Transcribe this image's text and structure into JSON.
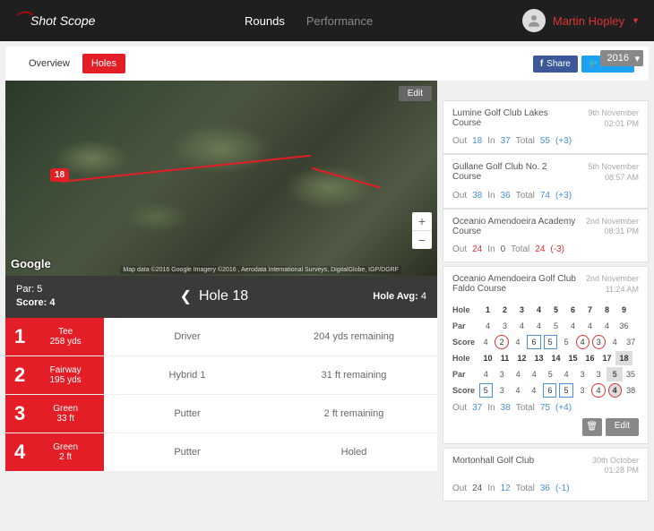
{
  "header": {
    "logo_text": "Shot Scope",
    "nav": {
      "rounds": "Rounds",
      "performance": "Performance"
    },
    "user_name": "Martin Hopley"
  },
  "toolbar": {
    "overview": "Overview",
    "holes": "Holes",
    "share": "Share",
    "tweet": "Tweet",
    "year": "2016"
  },
  "map": {
    "edit": "Edit",
    "google": "Google",
    "attribution": "Map data ©2016 Google Imagery ©2016 , Aerodata International Surveys, DigitalGlobe, IGP/DGRF",
    "hole_marker": "18"
  },
  "hole_bar": {
    "par_label": "Par:",
    "par_value": "5",
    "score_label": "Score:",
    "score_value": "4",
    "title": "Hole 18",
    "avg_label": "Hole Avg:",
    "avg_value": "4"
  },
  "shots": [
    {
      "n": "1",
      "lie": "Tee",
      "dist": "258 yds",
      "club": "Driver",
      "remain": "204 yds remaining"
    },
    {
      "n": "2",
      "lie": "Fairway",
      "dist": "195 yds",
      "club": "Hybrid 1",
      "remain": "31 ft remaining"
    },
    {
      "n": "3",
      "lie": "Green",
      "dist": "33 ft",
      "club": "Putter",
      "remain": "2 ft remaining"
    },
    {
      "n": "4",
      "lie": "Green",
      "dist": "2 ft",
      "club": "Putter",
      "remain": "Holed"
    }
  ],
  "rounds": [
    {
      "name": "Lumine Golf Club Lakes Course",
      "date": "9th November",
      "time": "02:01 PM",
      "out": "18",
      "in": "37",
      "total": "55",
      "delta": "(+3)",
      "out_red": false
    },
    {
      "name": "Gullane Golf Club No. 2 Course",
      "date": "5th November",
      "time": "08:57 AM",
      "out": "38",
      "in": "36",
      "total": "74",
      "delta": "(+3)",
      "out_red": false
    },
    {
      "name": "Oceanio Amendoeira Academy Course",
      "date": "2nd November",
      "time": "08:31 PM",
      "out": "24",
      "in": "0",
      "total": "24",
      "delta": "(-3)",
      "out_red": true,
      "in_black": true,
      "delta_red": true
    }
  ],
  "expanded": {
    "name": "Oceanio Amendoeira Golf Club Faldo Course",
    "date": "2nd November",
    "time": "11:24 AM",
    "labels": {
      "hole": "Hole",
      "par": "Par",
      "score": "Score"
    },
    "front": {
      "holes": [
        "1",
        "2",
        "3",
        "4",
        "5",
        "6",
        "7",
        "8",
        "9"
      ],
      "par": [
        "4",
        "3",
        "4",
        "4",
        "5",
        "4",
        "4",
        "4",
        "36"
      ],
      "score": [
        "4",
        "2",
        "4",
        "6",
        "5",
        "5",
        "4",
        "3",
        "4",
        "37"
      ]
    },
    "back": {
      "holes": [
        "10",
        "11",
        "12",
        "13",
        "14",
        "15",
        "16",
        "17",
        "18"
      ],
      "par": [
        "4",
        "3",
        "4",
        "4",
        "5",
        "4",
        "3",
        "3",
        "5",
        "35"
      ],
      "score": [
        "5",
        "3",
        "4",
        "4",
        "6",
        "5",
        "3",
        "4",
        "4",
        "38"
      ]
    },
    "summary": {
      "out": "37",
      "in": "38",
      "total": "75",
      "delta": "(+4)"
    },
    "edit": "Edit"
  },
  "last_round": {
    "name": "Mortonhall Golf Club",
    "date": "30th October",
    "time": "01:28 PM",
    "out": "24",
    "in": "12",
    "total": "36",
    "delta": "(-1)",
    "out_black": true
  },
  "labels": {
    "out": "Out",
    "in": "In",
    "total": "Total"
  }
}
